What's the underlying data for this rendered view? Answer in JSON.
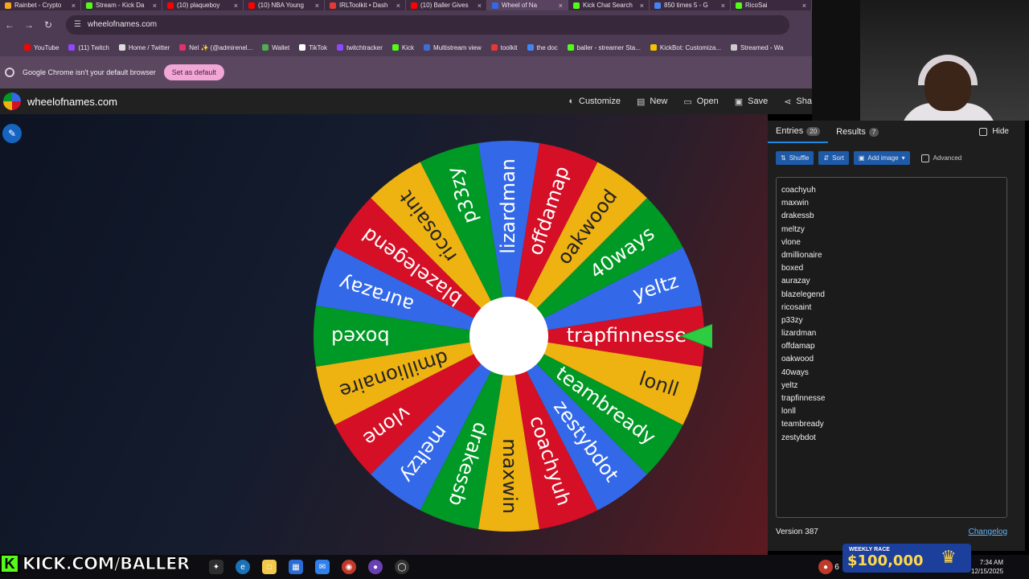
{
  "browser": {
    "tabs": [
      {
        "title": "Rainbet - Crypto",
        "color": "#f5a623"
      },
      {
        "title": "Stream - Kick Da",
        "color": "#53fc18"
      },
      {
        "title": "(10) plaqueboy",
        "color": "#ff0000"
      },
      {
        "title": "(10) NBA Young",
        "color": "#ff0000"
      },
      {
        "title": "IRLToolkit • Dash",
        "color": "#e53935"
      },
      {
        "title": "(10) Baller Gives",
        "color": "#ff0000"
      },
      {
        "title": "Wheel of Na",
        "color": "#3369e8",
        "active": true
      },
      {
        "title": "Kick Chat Search",
        "color": "#53fc18"
      },
      {
        "title": "850 times 5 - G",
        "color": "#4285f4"
      },
      {
        "title": "RicoSai",
        "color": "#53fc18"
      }
    ],
    "url": "wheelofnames.com",
    "bookmarks": [
      {
        "label": "YouTube",
        "color": "#ff0000"
      },
      {
        "label": "(11) Twitch",
        "color": "#9146ff"
      },
      {
        "label": "Home / Twitter",
        "color": "#dddddd"
      },
      {
        "label": "Nel ✨ (@admirenel...",
        "color": "#e1306c"
      },
      {
        "label": "Wallet",
        "color": "#4caf50"
      },
      {
        "label": "TikTok",
        "color": "#ffffff"
      },
      {
        "label": "twitchtracker",
        "color": "#9146ff"
      },
      {
        "label": "Kick",
        "color": "#53fc18"
      },
      {
        "label": "Multistream view",
        "color": "#3a6fd8"
      },
      {
        "label": "toolkit",
        "color": "#e53935"
      },
      {
        "label": "the doc",
        "color": "#4285f4"
      },
      {
        "label": "baller - streamer Sta...",
        "color": "#53fc18"
      },
      {
        "label": "KickBot: Customiza...",
        "color": "#f5c400"
      },
      {
        "label": "Streamed - Wa",
        "color": "#cccccc"
      }
    ],
    "infobar_text": "Google Chrome isn't your default browser",
    "set_default_label": "Set as default"
  },
  "site": {
    "name": "wheelofnames.com",
    "menu": [
      {
        "label": "Customize",
        "icon": "palette-icon"
      },
      {
        "label": "New",
        "icon": "file-icon"
      },
      {
        "label": "Open",
        "icon": "folder-icon"
      },
      {
        "label": "Save",
        "icon": "save-icon"
      },
      {
        "label": "Sha",
        "icon": "share-icon"
      }
    ]
  },
  "wheel": {
    "colors": [
      "#3369e8",
      "#009925",
      "#eeb211",
      "#d50f25"
    ],
    "segments": [
      "yeltz",
      "40ways",
      "oakwood",
      "offdamap",
      "lizardman",
      "p33zy",
      "ricosaint",
      "blazelegend",
      "aurazay",
      "boxed",
      "dmillionaire",
      "vlone",
      "meltzy",
      "drakessb",
      "maxwin",
      "coachyuh",
      "zestybdot",
      "teambready",
      "lonll",
      "trapfinnesse"
    ]
  },
  "panel": {
    "entries_label": "Entries",
    "entries_count": "20",
    "results_label": "Results",
    "results_count": "7",
    "hide_label": "Hide",
    "shuffle_label": "Shuffle",
    "sort_label": "Sort",
    "add_image_label": "Add image",
    "advanced_label": "Advanced",
    "entries": [
      "coachyuh",
      "maxwin",
      "drakessb",
      "meltzy",
      "vlone",
      "dmillionaire",
      "boxed",
      "aurazay",
      "blazelegend",
      "ricosaint",
      "p33zy",
      "lizardman",
      "offdamap",
      "oakwood",
      "40ways",
      "yeltz",
      "trapfinnesse",
      "lonll",
      "teambready",
      "zestybdot"
    ],
    "version": "Version 387",
    "changelog": "Changelog"
  },
  "overlay": {
    "kick_url": "KICK.COM/BALLER",
    "race_title": "WEEKLY RACE",
    "race_amount": "$100,000",
    "time": "7:34 AM",
    "date": "12/15/2025",
    "tray_number": "6"
  }
}
